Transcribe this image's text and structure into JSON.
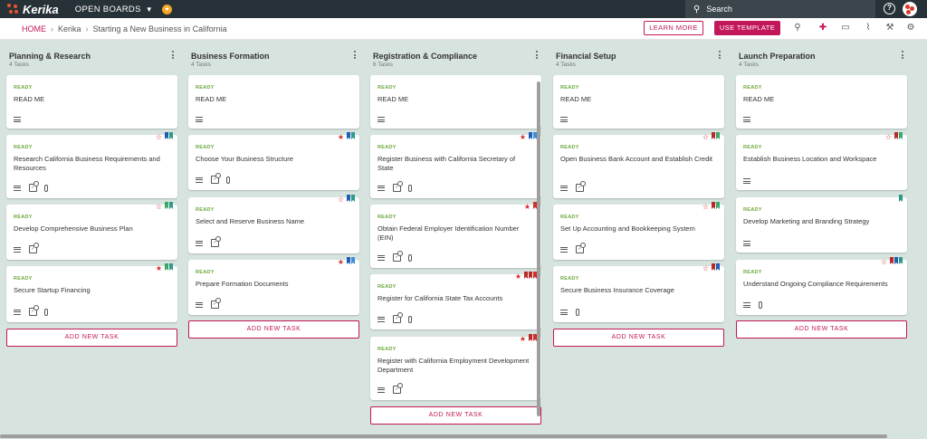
{
  "app": {
    "logo_text": "Kerika",
    "open_boards_label": "OPEN BOARDS",
    "search_placeholder": "Search"
  },
  "breadcrumb": {
    "home": "HOME",
    "org": "Kerika",
    "board": "Starting a New Business in California"
  },
  "header_buttons": {
    "learn_more": "LEARN MORE",
    "use_template": "USE TEMPLATE"
  },
  "colors": {
    "accent": "#c2185b",
    "ready": "#6aa83c",
    "star_red": "#d62d2d",
    "flag_blue": "#1e5fb4",
    "flag_green": "#3fa66a",
    "flag_teal": "#2e9a8a",
    "flag_darkred": "#b72a2a",
    "flag_sky": "#3d8fd9"
  },
  "add_task_label": "ADD NEW TASK",
  "columns": [
    {
      "title": "Planning & Research",
      "count": "4 Tasks",
      "cards": [
        {
          "status": "READY",
          "title": "READ ME"
        },
        {
          "status": "READY",
          "title": "Research California Business Requirements and Resources"
        },
        {
          "status": "READY",
          "title": "Develop Comprehensive Business Plan"
        },
        {
          "status": "READY",
          "title": "Secure Startup Financing"
        }
      ]
    },
    {
      "title": "Business Formation",
      "count": "4 Tasks",
      "cards": [
        {
          "status": "READY",
          "title": "READ ME"
        },
        {
          "status": "READY",
          "title": "Choose Your Business Structure"
        },
        {
          "status": "READY",
          "title": "Select and Reserve Business Name"
        },
        {
          "status": "READY",
          "title": "Prepare Formation Documents"
        }
      ]
    },
    {
      "title": "Registration & Compliance",
      "count": "6 Tasks",
      "cards": [
        {
          "status": "READY",
          "title": "READ ME"
        },
        {
          "status": "READY",
          "title": "Register Business with California Secretary of State"
        },
        {
          "status": "READY",
          "title": "Obtain Federal Employer Identification Number (EIN)"
        },
        {
          "status": "READY",
          "title": "Register for California State Tax Accounts"
        },
        {
          "status": "READY",
          "title": "Register with California Employment Development Department"
        }
      ]
    },
    {
      "title": "Financial Setup",
      "count": "4 Tasks",
      "cards": [
        {
          "status": "READY",
          "title": "READ ME"
        },
        {
          "status": "READY",
          "title": "Open Business Bank Account and Establish Credit"
        },
        {
          "status": "READY",
          "title": "Set Up Accounting and Bookkeeping System"
        },
        {
          "status": "READY",
          "title": "Secure Business Insurance Coverage"
        }
      ]
    },
    {
      "title": "Launch Preparation",
      "count": "4 Tasks",
      "cards": [
        {
          "status": "READY",
          "title": "READ ME"
        },
        {
          "status": "READY",
          "title": "Establish Business Location and Workspace"
        },
        {
          "status": "READY",
          "title": "Develop Marketing and Branding Strategy"
        },
        {
          "status": "READY",
          "title": "Understand Ongoing Compliance Requirements"
        }
      ]
    }
  ]
}
